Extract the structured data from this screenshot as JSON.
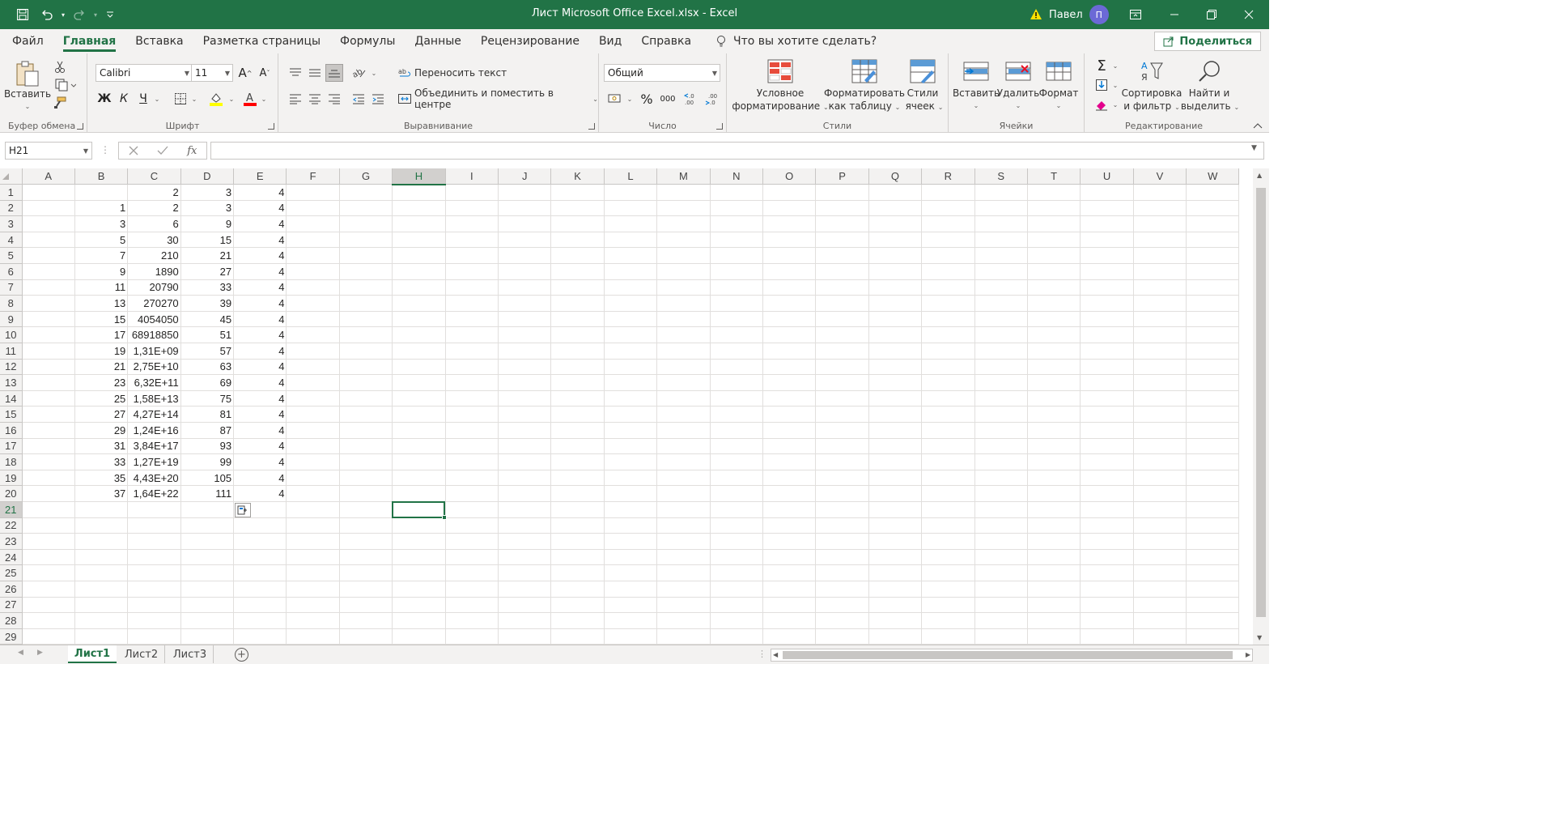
{
  "window": {
    "title": "Лист Microsoft Office Excel.xlsx  -  Excel",
    "user": "Павел",
    "avatar_initial": "П"
  },
  "tabs": [
    "Файл",
    "Главная",
    "Вставка",
    "Разметка страницы",
    "Формулы",
    "Данные",
    "Рецензирование",
    "Вид",
    "Справка"
  ],
  "active_tab": "Главная",
  "tell_me": "Что вы хотите сделать?",
  "share": "Поделиться",
  "ribbon": {
    "clipboard": {
      "label": "Буфер обмена",
      "paste": "Вставить"
    },
    "font": {
      "label": "Шрифт",
      "name": "Calibri",
      "size": "11",
      "bold": "Ж",
      "italic": "К",
      "underline": "Ч"
    },
    "alignment": {
      "label": "Выравнивание",
      "wrap": "Переносить текст",
      "merge": "Объединить и поместить в центре"
    },
    "number": {
      "label": "Число",
      "format": "Общий"
    },
    "styles": {
      "label": "Стили",
      "cond1": "Условное",
      "cond2": "форматирование",
      "table1": "Форматировать",
      "table2": "как таблицу",
      "cell1": "Стили",
      "cell2": "ячеек"
    },
    "cells": {
      "label": "Ячейки",
      "insert": "Вставить",
      "delete": "Удалить",
      "format": "Формат"
    },
    "editing": {
      "label": "Редактирование",
      "sort1": "Сортировка",
      "sort2": "и фильтр",
      "find1": "Найти и",
      "find2": "выделить"
    }
  },
  "namebox": "H21",
  "columns": [
    "A",
    "B",
    "C",
    "D",
    "E",
    "F",
    "G",
    "H",
    "I",
    "J",
    "K",
    "L",
    "M",
    "N",
    "O",
    "P",
    "Q",
    "R",
    "S",
    "T",
    "U",
    "V",
    "W"
  ],
  "selected_col": "H",
  "selected_row": 21,
  "rows": [
    [
      "",
      "",
      "2",
      "3",
      "4"
    ],
    [
      "",
      "1",
      "2",
      "3",
      "4"
    ],
    [
      "",
      "3",
      "6",
      "9",
      "4"
    ],
    [
      "",
      "5",
      "30",
      "15",
      "4"
    ],
    [
      "",
      "7",
      "210",
      "21",
      "4"
    ],
    [
      "",
      "9",
      "1890",
      "27",
      "4"
    ],
    [
      "",
      "11",
      "20790",
      "33",
      "4"
    ],
    [
      "",
      "13",
      "270270",
      "39",
      "4"
    ],
    [
      "",
      "15",
      "4054050",
      "45",
      "4"
    ],
    [
      "",
      "17",
      "68918850",
      "51",
      "4"
    ],
    [
      "",
      "19",
      "1,31E+09",
      "57",
      "4"
    ],
    [
      "",
      "21",
      "2,75E+10",
      "63",
      "4"
    ],
    [
      "",
      "23",
      "6,32E+11",
      "69",
      "4"
    ],
    [
      "",
      "25",
      "1,58E+13",
      "75",
      "4"
    ],
    [
      "",
      "27",
      "4,27E+14",
      "81",
      "4"
    ],
    [
      "",
      "29",
      "1,24E+16",
      "87",
      "4"
    ],
    [
      "",
      "31",
      "3,84E+17",
      "93",
      "4"
    ],
    [
      "",
      "33",
      "1,27E+19",
      "99",
      "4"
    ],
    [
      "",
      "35",
      "4,43E+20",
      "105",
      "4"
    ],
    [
      "",
      "37",
      "1,64E+22",
      "111",
      "4"
    ],
    [],
    [],
    [],
    [],
    [],
    [],
    [],
    [],
    []
  ],
  "sheets": [
    "Лист1",
    "Лист2",
    "Лист3"
  ],
  "active_sheet": "Лист1"
}
